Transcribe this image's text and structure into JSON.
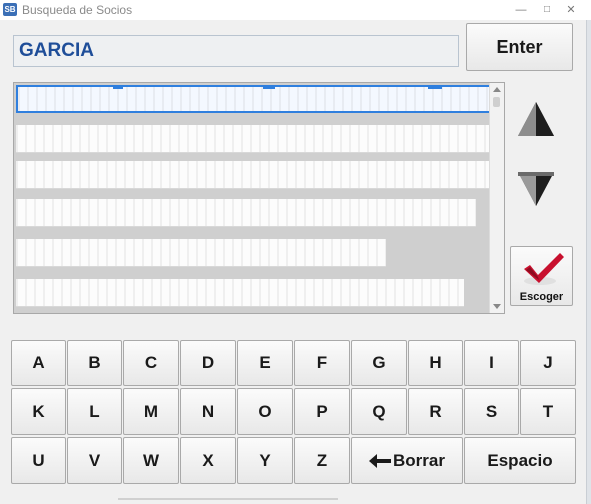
{
  "window": {
    "title": "Busqueda de Socios",
    "icon_label": "SB"
  },
  "search": {
    "value": "GARCIA"
  },
  "enter_label": "Enter",
  "escoger_label": "Escoger",
  "results": {
    "rows": [
      "",
      "",
      "",
      "",
      "",
      ""
    ],
    "selected_index": 0
  },
  "keyboard": {
    "row1": [
      "A",
      "B",
      "C",
      "D",
      "E",
      "F",
      "G",
      "H",
      "I",
      "J"
    ],
    "row2": [
      "K",
      "L",
      "M",
      "N",
      "O",
      "P",
      "Q",
      "R",
      "S",
      "T"
    ],
    "row3": [
      "U",
      "V",
      "W",
      "X",
      "Y",
      "Z"
    ],
    "borrar_label": "Borrar",
    "espacio_label": "Espacio"
  },
  "colors": {
    "search_text": "#1f4e99",
    "selection": "#2f7fde",
    "check": "#c8102e"
  }
}
